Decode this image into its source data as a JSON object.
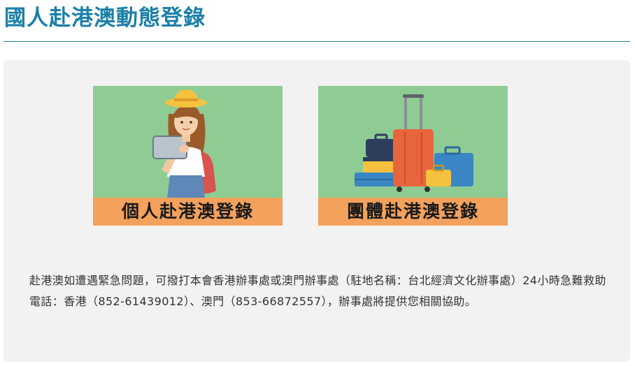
{
  "page": {
    "title": "國人赴港澳動態登錄"
  },
  "cards": {
    "personal": {
      "label": "個人赴港澳登錄",
      "icon": "traveler-with-tablet-illustration"
    },
    "group": {
      "label": "團體赴港澳登錄",
      "icon": "luggage-illustration"
    }
  },
  "notice": {
    "text": "赴港澳如遭遇緊急問題，可撥打本會香港辦事處或澳門辦事處（駐地名稱：台北經濟文化辦事處）24小時急難救助電話：香港（852-61439012）、澳門（853-66872557），辦事處將提供您相關協助。"
  },
  "colors": {
    "title": "#1b7fa8",
    "panel_bg": "#f2f2f2",
    "card_bg": "#8fcc94",
    "card_label_bg": "#f3a15c"
  }
}
